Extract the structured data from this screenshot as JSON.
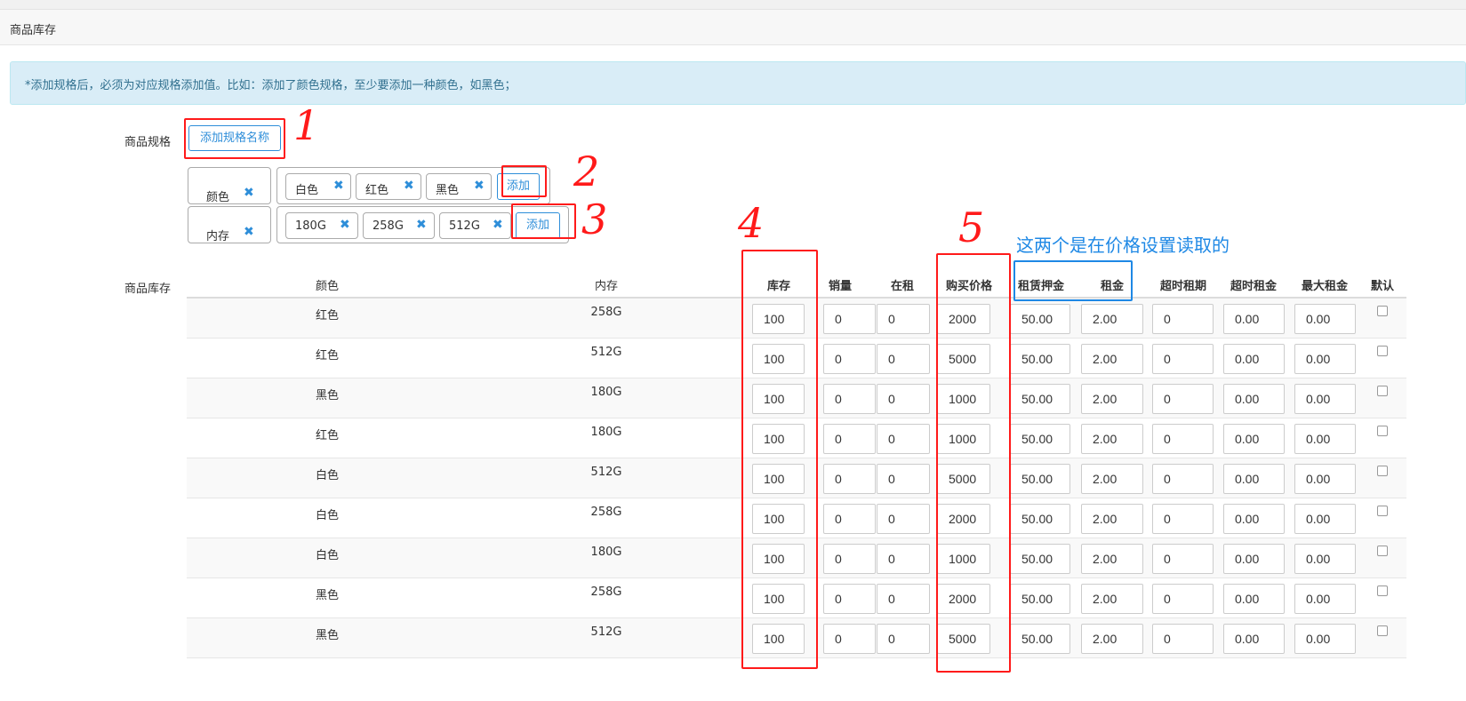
{
  "panel": {
    "title": "商品库存"
  },
  "alert": {
    "text": "*添加规格后，必须为对应规格添加值。比如：添加了颜色规格，至少要添加一种颜色，如黑色；"
  },
  "spec": {
    "label": "商品规格",
    "add_name_button": "添加规格名称",
    "add_value_button": "添加",
    "groups": [
      {
        "name": "颜色",
        "values": [
          "白色",
          "红色",
          "黑色"
        ]
      },
      {
        "name": "内存",
        "values": [
          "180G",
          "258G",
          "512G"
        ]
      }
    ]
  },
  "stock": {
    "label": "商品库存",
    "headers": [
      "颜色",
      "内存",
      "库存",
      "销量",
      "在租",
      "购买价格",
      "租赁押金",
      "租金",
      "超时租期",
      "超时租金",
      "最大租金",
      "默认"
    ],
    "rows": [
      {
        "color": "红色",
        "memory": "258G",
        "stock": "100",
        "sales": "0",
        "renting": "0",
        "price": "2000",
        "deposit": "50.00",
        "rent": "2.00",
        "overdue_period": "0",
        "overdue_rent": "0.00",
        "max_rent": "0.00",
        "default": false
      },
      {
        "color": "红色",
        "memory": "512G",
        "stock": "100",
        "sales": "0",
        "renting": "0",
        "price": "5000",
        "deposit": "50.00",
        "rent": "2.00",
        "overdue_period": "0",
        "overdue_rent": "0.00",
        "max_rent": "0.00",
        "default": false
      },
      {
        "color": "黑色",
        "memory": "180G",
        "stock": "100",
        "sales": "0",
        "renting": "0",
        "price": "1000",
        "deposit": "50.00",
        "rent": "2.00",
        "overdue_period": "0",
        "overdue_rent": "0.00",
        "max_rent": "0.00",
        "default": false
      },
      {
        "color": "红色",
        "memory": "180G",
        "stock": "100",
        "sales": "0",
        "renting": "0",
        "price": "1000",
        "deposit": "50.00",
        "rent": "2.00",
        "overdue_period": "0",
        "overdue_rent": "0.00",
        "max_rent": "0.00",
        "default": false
      },
      {
        "color": "白色",
        "memory": "512G",
        "stock": "100",
        "sales": "0",
        "renting": "0",
        "price": "5000",
        "deposit": "50.00",
        "rent": "2.00",
        "overdue_period": "0",
        "overdue_rent": "0.00",
        "max_rent": "0.00",
        "default": false
      },
      {
        "color": "白色",
        "memory": "258G",
        "stock": "100",
        "sales": "0",
        "renting": "0",
        "price": "2000",
        "deposit": "50.00",
        "rent": "2.00",
        "overdue_period": "0",
        "overdue_rent": "0.00",
        "max_rent": "0.00",
        "default": false
      },
      {
        "color": "白色",
        "memory": "180G",
        "stock": "100",
        "sales": "0",
        "renting": "0",
        "price": "1000",
        "deposit": "50.00",
        "rent": "2.00",
        "overdue_period": "0",
        "overdue_rent": "0.00",
        "max_rent": "0.00",
        "default": false
      },
      {
        "color": "黑色",
        "memory": "258G",
        "stock": "100",
        "sales": "0",
        "renting": "0",
        "price": "2000",
        "deposit": "50.00",
        "rent": "2.00",
        "overdue_period": "0",
        "overdue_rent": "0.00",
        "max_rent": "0.00",
        "default": false
      },
      {
        "color": "黑色",
        "memory": "512G",
        "stock": "100",
        "sales": "0",
        "renting": "0",
        "price": "5000",
        "deposit": "50.00",
        "rent": "2.00",
        "overdue_period": "0",
        "overdue_rent": "0.00",
        "max_rent": "0.00",
        "default": false
      }
    ]
  },
  "annotations": {
    "numbers": [
      "1",
      "2",
      "3",
      "4",
      "5"
    ],
    "blue_note": "这两个是在价格设置读取的",
    "red_color": "#ff1a1a",
    "blue_color": "#1e88e5"
  },
  "icons": {
    "remove": "close-icon"
  },
  "colors": {
    "accent": "#2e8ed9",
    "alert_bg": "#d9edf7",
    "alert_text": "#31708f"
  }
}
